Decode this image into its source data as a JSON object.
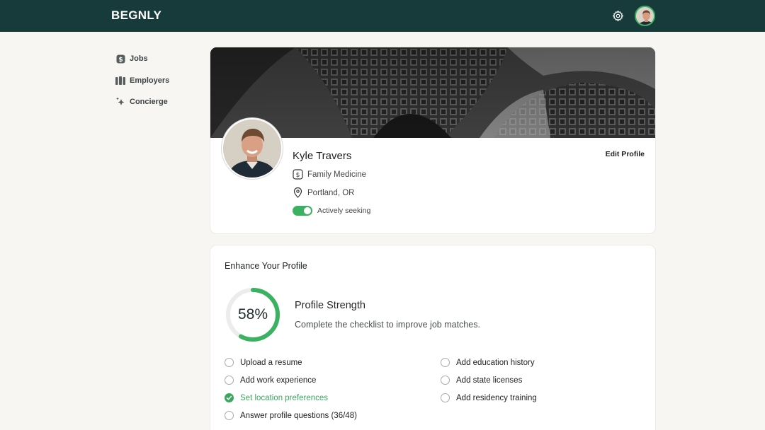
{
  "topbar": {
    "logo": "BEGNLY"
  },
  "sidebar": {
    "items": [
      {
        "label": "Jobs",
        "icon": "dollar-badge-icon"
      },
      {
        "label": "Employers",
        "icon": "buildings-icon"
      },
      {
        "label": "Concierge",
        "icon": "sparkle-icon"
      }
    ]
  },
  "profile": {
    "name": "Kyle Travers",
    "specialty": "Family Medicine",
    "location": "Portland, OR",
    "status": "Actively seeking",
    "status_on": true,
    "edit_label": "Edit Profile"
  },
  "enhance": {
    "title": "Enhance Your Profile",
    "strength_percent_label": "58%",
    "strength_value": 0.58,
    "strength_title": "Profile Strength",
    "strength_subtitle": "Complete the checklist to improve job matches.",
    "checklist": [
      {
        "label": "Upload a resume",
        "done": false
      },
      {
        "label": "Add work experience",
        "done": false
      },
      {
        "label": "Set location preferences",
        "done": true
      },
      {
        "label": "Answer profile questions (36/48)",
        "done": false
      },
      {
        "label": "Add education history",
        "done": false
      },
      {
        "label": "Add state licenses",
        "done": false
      },
      {
        "label": "Add residency training",
        "done": false
      }
    ]
  },
  "colors": {
    "header": "#173b3b",
    "accent": "#3ab262",
    "background": "#f7f6f2"
  }
}
